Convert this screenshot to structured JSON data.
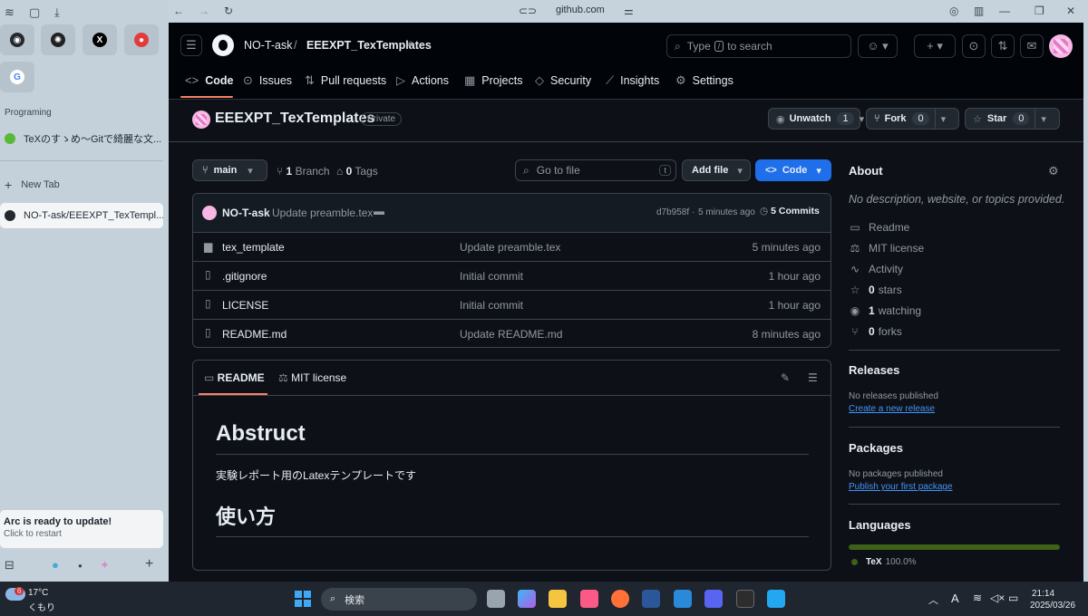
{
  "browser": {
    "url": "github.com",
    "sidebar": {
      "favorites": [
        {
          "name": "github-favicon",
          "color": "#24292f"
        },
        {
          "name": "openai-favicon",
          "color": "#202123"
        },
        {
          "name": "x-favicon",
          "color": "#000000"
        },
        {
          "name": "app-favicon",
          "color": "#e23b3b"
        },
        {
          "name": "google-favicon",
          "color": "#4285f4"
        }
      ],
      "section_label": "Programing",
      "pinned_tab": "TeXのすゝめ〜Gitで綺麗な文...",
      "new_tab_label": "New Tab",
      "active_tab": "NO-T-ask/EEEXPT_TexTempl...",
      "update_card": {
        "title": "Arc is ready to update!",
        "subtitle": "Click to restart"
      }
    }
  },
  "github": {
    "header": {
      "owner": "NO-T-ask",
      "separator": "/",
      "repo": "EEEXPT_TexTemplates",
      "search_prefix": "Type",
      "search_key": "/",
      "search_suffix": "to search"
    },
    "tabs": [
      {
        "label": "Code",
        "icon": "code-icon",
        "glyph": "<>"
      },
      {
        "label": "Issues",
        "icon": "issue-icon",
        "glyph": "⊙"
      },
      {
        "label": "Pull requests",
        "icon": "pull-request-icon",
        "glyph": "⇅"
      },
      {
        "label": "Actions",
        "icon": "play-icon",
        "glyph": "▷"
      },
      {
        "label": "Projects",
        "icon": "table-icon",
        "glyph": "▦"
      },
      {
        "label": "Security",
        "icon": "shield-icon",
        "glyph": "◇"
      },
      {
        "label": "Insights",
        "icon": "graph-icon",
        "glyph": "⟋"
      },
      {
        "label": "Settings",
        "icon": "gear-icon",
        "glyph": "⚙"
      }
    ],
    "repo_title": "EEEXPT_TexTemplates",
    "visibility": "Private",
    "actions": {
      "unwatch": {
        "label": "Unwatch",
        "count": "1"
      },
      "fork": {
        "label": "Fork",
        "count": "0"
      },
      "star": {
        "label": "Star",
        "count": "0"
      }
    },
    "branch": "main",
    "branch_count": "1",
    "branch_label": "Branch",
    "tag_count": "0",
    "tag_label": "Tags",
    "go_to_file": "Go to file",
    "go_to_file_key": "t",
    "add_file": "Add file",
    "code_button": "Code",
    "latest_commit": {
      "author": "NO-T-ask",
      "message": "Update preamble.tex",
      "hash": "d7b958f",
      "time": "5 minutes ago",
      "commits_count": "5",
      "commits_label": "Commits"
    },
    "files": [
      {
        "name": "tex_template",
        "type": "folder",
        "message": "Update preamble.tex",
        "time": "5 minutes ago"
      },
      {
        "name": ".gitignore",
        "type": "file",
        "message": "Initial commit",
        "time": "1 hour ago"
      },
      {
        "name": "LICENSE",
        "type": "file",
        "message": "Initial commit",
        "time": "1 hour ago"
      },
      {
        "name": "README.md",
        "type": "file",
        "message": "Update README.md",
        "time": "8 minutes ago"
      }
    ],
    "readme": {
      "tab_readme": "README",
      "tab_license": "MIT license",
      "h1": "Abstruct",
      "paragraph": "実験レポート用のLatexテンプレートです",
      "h2": "使い方"
    },
    "about": {
      "title": "About",
      "description": "No description, website, or topics provided.",
      "items": [
        {
          "icon": "book-icon",
          "glyph": "📖",
          "bold": "",
          "text": "Readme"
        },
        {
          "icon": "law-icon",
          "glyph": "⚖",
          "bold": "",
          "text": "MIT license"
        },
        {
          "icon": "pulse-icon",
          "glyph": "∿",
          "bold": "",
          "text": "Activity"
        },
        {
          "icon": "star-icon",
          "glyph": "☆",
          "bold": "0",
          "text": "stars"
        },
        {
          "icon": "eye-icon",
          "glyph": "◉",
          "bold": "1",
          "text": "watching"
        },
        {
          "icon": "fork-icon",
          "glyph": "⑂",
          "bold": "0",
          "text": "forks"
        }
      ]
    },
    "releases": {
      "title": "Releases",
      "empty": "No releases published",
      "link": "Create a new release"
    },
    "packages": {
      "title": "Packages",
      "empty": "No packages published",
      "link": "Publish your first package"
    },
    "languages": {
      "title": "Languages",
      "items": [
        {
          "name": "TeX",
          "percent": "100.0%",
          "color": "#3d6117"
        }
      ]
    }
  },
  "taskbar": {
    "weather_temp": "17°C",
    "weather_desc": "くもり",
    "weather_badge": "6",
    "search_label": "検索",
    "time": "21:14",
    "date": "2025/03/26",
    "ime": "A"
  }
}
